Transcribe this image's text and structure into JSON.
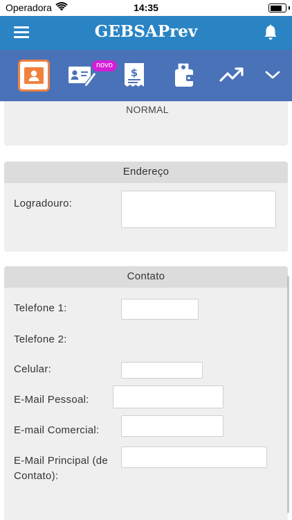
{
  "status_bar": {
    "carrier": "Operadora",
    "time": "14:35",
    "battery_level": 0.9
  },
  "header": {
    "title": "GEBSAPrev",
    "menu_icon": "hamburger-menu-icon",
    "notification_icon": "bell-icon",
    "color": "#2a84c4"
  },
  "toolbar": {
    "color": "#4a72b8",
    "active_color": "#f0813e",
    "items": [
      {
        "icon": "profile-card-icon",
        "active": true
      },
      {
        "icon": "id-card-pen-icon",
        "badge": "novo"
      },
      {
        "icon": "receipt-dollar-icon"
      },
      {
        "icon": "wallet-icon"
      },
      {
        "icon": "trending-up-icon"
      },
      {
        "icon": "chevron-down-icon"
      }
    ]
  },
  "profile_status": {
    "value": "NORMAL"
  },
  "endereco": {
    "title": "Endereço",
    "fields": [
      {
        "label": "Logradouro:",
        "value": ""
      }
    ]
  },
  "contato": {
    "title": "Contato",
    "fields": [
      {
        "label": "Telefone 1:",
        "value": ""
      },
      {
        "label": "Telefone 2:",
        "value": ""
      },
      {
        "label": "Celular:",
        "value": ""
      },
      {
        "label": "E-Mail Pessoal:",
        "value": ""
      },
      {
        "label": "E-mail Comercial:",
        "value": ""
      },
      {
        "label": "E-Mail Principal (de Contato):",
        "value": ""
      }
    ]
  }
}
